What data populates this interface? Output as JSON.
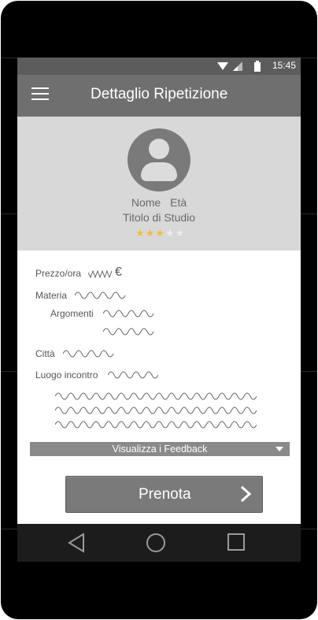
{
  "status_bar": {
    "time": "15:45",
    "icons": [
      "wifi-icon",
      "signal-icon",
      "battery-icon"
    ]
  },
  "app_bar": {
    "title": "Dettaglio Ripetizione",
    "menu_icon": "menu-icon"
  },
  "profile": {
    "name_label": "Nome",
    "age_label": "Età",
    "degree_label": "Titolo di Studio",
    "rating": {
      "value": 3,
      "max": 5
    },
    "avatar_icon": "person-icon"
  },
  "details": {
    "price_label": "Prezzo/ora",
    "currency": "€",
    "subject_label": "Materia",
    "topics_label": "Argomenti",
    "city_label": "Città",
    "meeting_label": "Luogo incontro"
  },
  "feedback": {
    "label": "Visualizza i Feedback"
  },
  "book_button": {
    "label": "Prenota"
  },
  "nav_bar": {
    "icons": [
      "back-icon",
      "home-icon",
      "recents-icon"
    ]
  },
  "colors": {
    "app_bar": "#6f6f6f",
    "profile_bg": "#d8d8d8",
    "star_active": "#f2c12e",
    "button": "#7a7a7a"
  }
}
